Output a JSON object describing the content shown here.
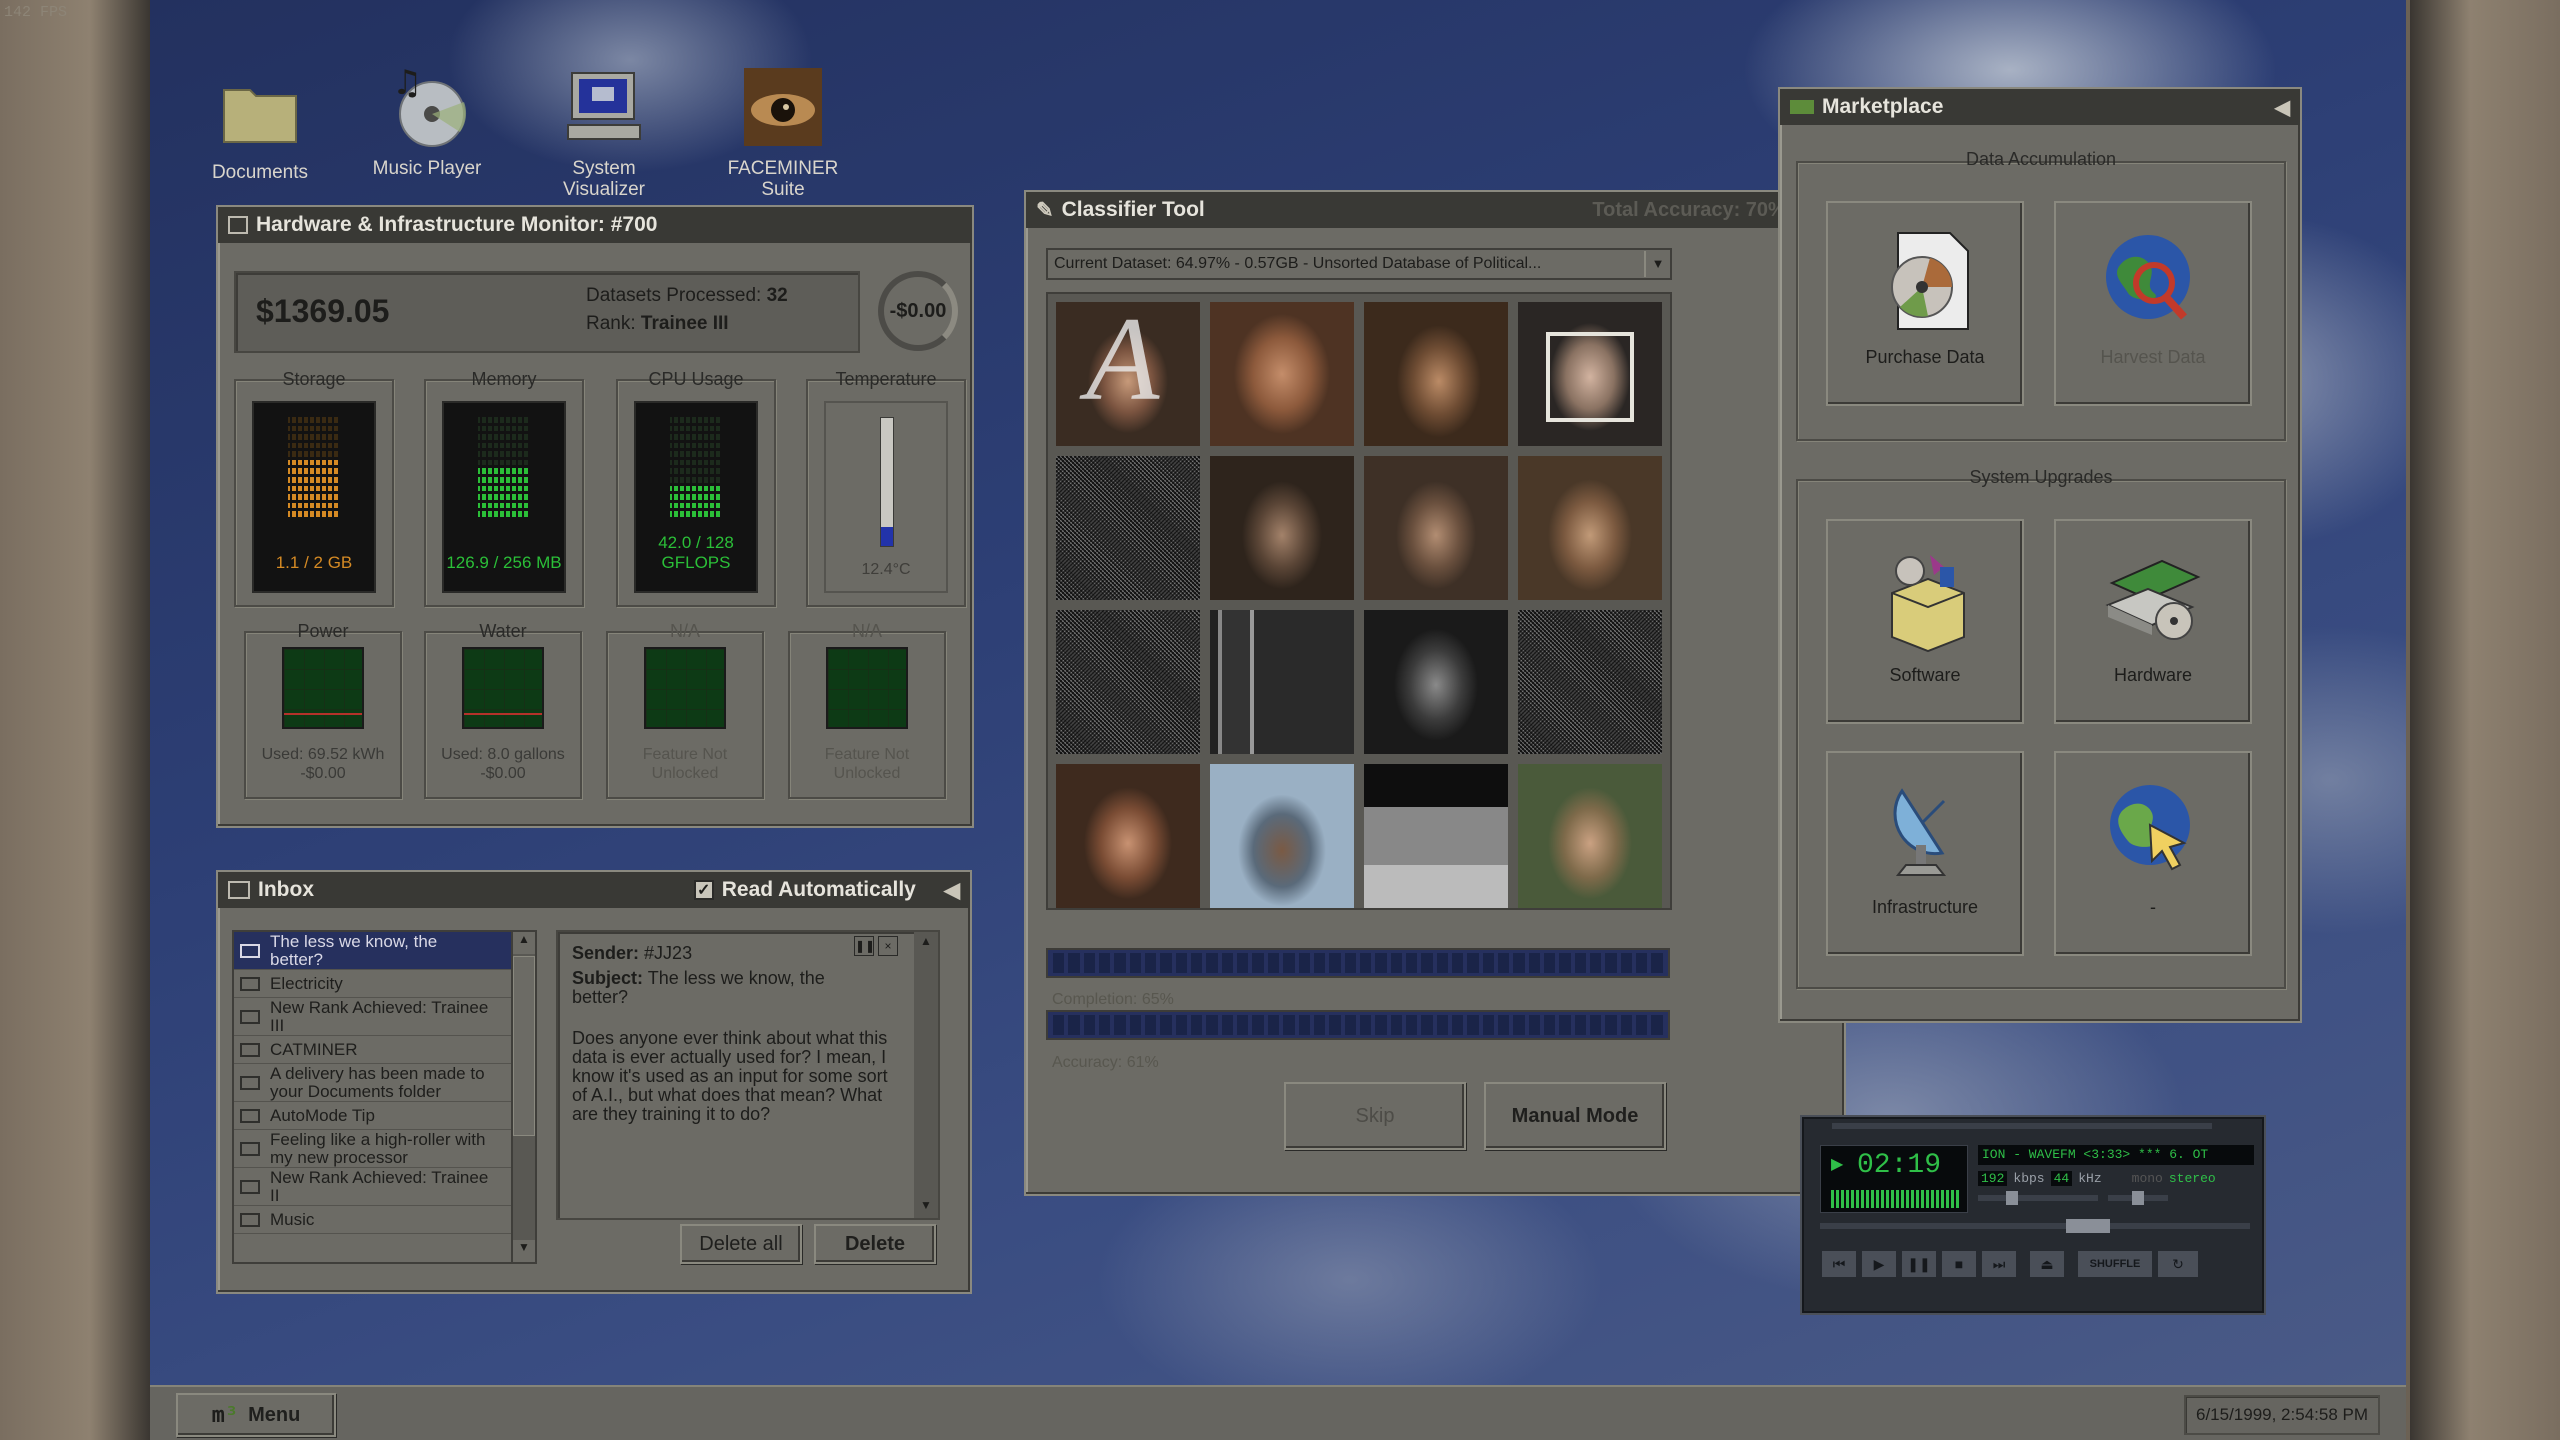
{
  "fps": "142 FPS",
  "desktop_icons": [
    {
      "label": "Documents",
      "icon": "folder-icon"
    },
    {
      "label": "Music Player",
      "icon": "music-cd-icon"
    },
    {
      "label": "System\nVisualizer",
      "icon": "computer-icon"
    },
    {
      "label": "FACEMINER\nSuite",
      "icon": "eye-icon"
    }
  ],
  "hardware": {
    "title": "Hardware & Infrastructure Monitor: #700",
    "money": "$1369.05",
    "datasets_label": "Datasets Processed:",
    "datasets_value": "32",
    "rank_label": "Rank:",
    "rank_value": "Trainee III",
    "rate": "-$0.00",
    "gauges": [
      {
        "name": "Storage",
        "value": "1.1 / 2 GB",
        "color": "#d58a24",
        "fill": 0.55
      },
      {
        "name": "Memory",
        "value": "126.9 / 256 MB",
        "color": "#2bbf38",
        "fill": 0.5
      },
      {
        "name": "CPU Usage",
        "value": "42.0 / 128\nGFLOPS",
        "color": "#2bbf38",
        "fill": 0.33
      },
      {
        "name": "Temperature",
        "value": "12.4°C",
        "color": "#2233aa",
        "fill": 0.15
      }
    ],
    "utilities": [
      {
        "name": "Power",
        "value": "Used: 69.52 kWh\n-$0.00"
      },
      {
        "name": "Water",
        "value": "Used: 8.0 gallons\n-$0.00"
      },
      {
        "name": "N/A",
        "value": "Feature Not\nUnlocked"
      },
      {
        "name": "N/A",
        "value": "Feature Not\nUnlocked"
      }
    ]
  },
  "classifier": {
    "title": "Classifier Tool",
    "total_accuracy": "Total Accuracy: 70%",
    "dataset": "Current Dataset: 64.97% - 0.57GB - Unsorted Database of Political...",
    "completion": "Completion: 65%",
    "accuracy": "Accuracy: 61%",
    "skip": "Skip",
    "manual": "Manual Mode",
    "overlay_letter": "A"
  },
  "inbox": {
    "title": "Inbox",
    "read_auto": "Read Automatically",
    "items": [
      "The less we know, the better?",
      "Electricity",
      "New Rank Achieved: Trainee III",
      "CATMINER",
      "A delivery has been made to your Documents folder",
      "AutoMode Tip",
      "Feeling like a high-roller with my new processor",
      "New Rank Achieved: Trainee II",
      "Music"
    ],
    "sender_label": "Sender:",
    "sender": "#JJ23",
    "subject_label": "Subject:",
    "subject": "The less we know, the better?",
    "body": "Does anyone ever think about what this data is ever actually used for? I mean, I know it's used as an input for some sort of A.I., but what does that mean? What are they training it to do?",
    "delete_all": "Delete all",
    "delete": "Delete"
  },
  "marketplace": {
    "title": "Marketplace",
    "data_heading": "Data Accumulation",
    "upgrades_heading": "System Upgrades",
    "purchase": "Purchase Data",
    "harvest": "Harvest Data",
    "software": "Software",
    "hardware": "Hardware",
    "infrastructure": "Infrastructure",
    "unknown": "-"
  },
  "player": {
    "time": "02:19",
    "track": "ION - WAVEFM <3:33> *** 6. OT",
    "kbps": "192",
    "kbps_label": "kbps",
    "khz": "44",
    "khz_label": "kHz",
    "mono": "mono",
    "stereo": "stereo",
    "shuffle": "SHUFFLE"
  },
  "taskbar": {
    "menu": "Menu",
    "clock": "6/15/1999, 2:54:58 PM"
  }
}
